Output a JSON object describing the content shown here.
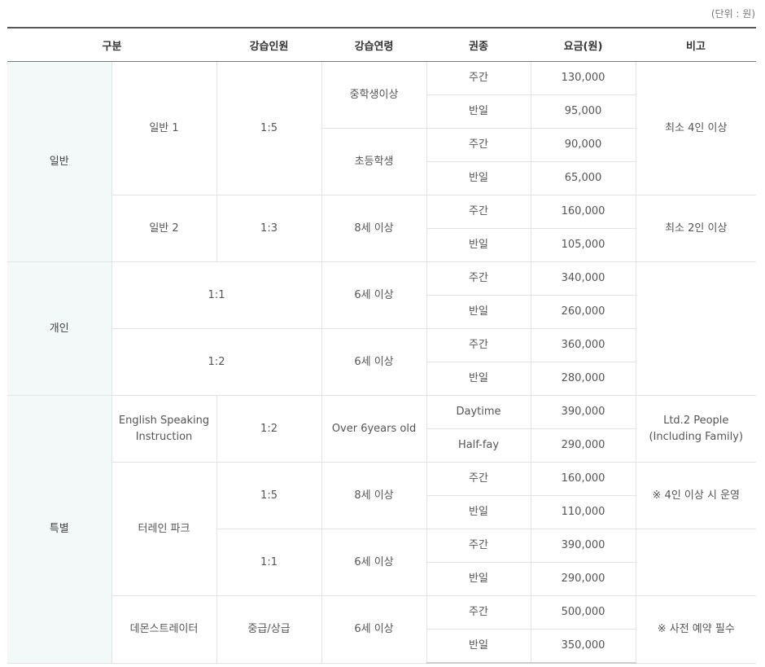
{
  "unit_note": "(단위 : 원)",
  "headers": {
    "category": "구분",
    "count": "강습인원",
    "age": "강습연령",
    "ticket": "권종",
    "price": "요금(원)",
    "note": "비고"
  },
  "general": {
    "category": "일반",
    "g1": {
      "name": "일반 1",
      "count": "1:5",
      "note": "최소 4인 이상",
      "middle": {
        "age": "중학생이상",
        "day": {
          "ticket": "주간",
          "price": "130,000"
        },
        "half": {
          "ticket": "반일",
          "price": "95,000"
        }
      },
      "elem": {
        "age": "초등학생",
        "day": {
          "ticket": "주간",
          "price": "90,000"
        },
        "half": {
          "ticket": "반일",
          "price": "65,000"
        }
      }
    },
    "g2": {
      "name": "일반 2",
      "count": "1:3",
      "age": "8세 이상",
      "note": "최소 2인 이상",
      "day": {
        "ticket": "주간",
        "price": "160,000"
      },
      "half": {
        "ticket": "반일",
        "price": "105,000"
      }
    }
  },
  "private": {
    "category": "개인",
    "p1": {
      "count": "1:1",
      "age": "6세 이상",
      "day": {
        "ticket": "주간",
        "price": "340,000"
      },
      "half": {
        "ticket": "반일",
        "price": "260,000"
      }
    },
    "p2": {
      "count": "1:2",
      "age": "6세 이상",
      "day": {
        "ticket": "주간",
        "price": "360,000"
      },
      "half": {
        "ticket": "반일",
        "price": "280,000"
      }
    }
  },
  "special": {
    "category": "특별",
    "english": {
      "name": "English Speaking\nInstruction",
      "count": "1:2",
      "age": "Over 6years old",
      "note": "Ltd.2 People\n(Including Family)",
      "day": {
        "ticket": "Daytime",
        "price": "390,000"
      },
      "half": {
        "ticket": "Half-fay",
        "price": "290,000"
      }
    },
    "terrain": {
      "name": "터레인 파크",
      "five": {
        "count": "1:5",
        "age": "8세 이상",
        "note": "※ 4인 이상 시 운영",
        "day": {
          "ticket": "주간",
          "price": "160,000"
        },
        "half": {
          "ticket": "반일",
          "price": "110,000"
        }
      },
      "one": {
        "count": "1:1",
        "age": "6세 이상",
        "day": {
          "ticket": "주간",
          "price": "390,000"
        },
        "half": {
          "ticket": "반일",
          "price": "290,000"
        }
      }
    },
    "demo": {
      "name": "데몬스트레이터",
      "count": "중급/상급",
      "age": "6세 이상",
      "note": "※ 사전 예약 필수",
      "day": {
        "ticket": "주간",
        "price": "500,000"
      },
      "half": {
        "ticket": "반일",
        "price": "350,000"
      }
    }
  }
}
